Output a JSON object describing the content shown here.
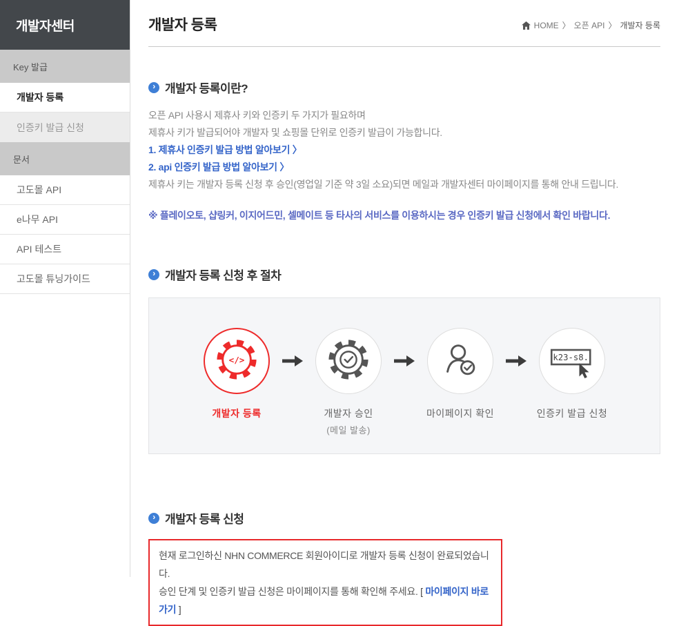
{
  "colors": {
    "accent_blue": "#3e7fd6",
    "link_blue": "#3464c9",
    "notice_indigo": "#5a69c3",
    "step_red": "#ee2b2b",
    "sidebar_dark": "#43474b"
  },
  "sidebar": {
    "title": "개발자센터",
    "items": [
      {
        "label": "Key 발급"
      },
      {
        "label": "개발자 등록"
      },
      {
        "label": "인증키 발급 신청"
      },
      {
        "label": "문서"
      },
      {
        "label": "고도몰 API"
      },
      {
        "label": "e나무 API"
      },
      {
        "label": "API 테스트"
      },
      {
        "label": "고도몰 튜닝가이드"
      }
    ]
  },
  "header": {
    "title": "개발자 등록",
    "breadcrumb": {
      "items": [
        "HOME",
        "오픈 API",
        "개발자 등록"
      ],
      "separator": "〉"
    }
  },
  "section1": {
    "heading": "개발자 등록이란?",
    "lines": [
      "오픈 API 사용시 제휴사 키와 인증키 두 가지가 필요하며",
      "제휴사 키가 발급되어야 개발자 및 쇼핑몰 단위로 인증키 발급이 가능합니다."
    ],
    "links": [
      {
        "label": "1. 제휴사 인증키 발급 방법 알아보기 〉"
      },
      {
        "label": "2. api 인증키 발급 방법 알아보기 〉"
      }
    ],
    "note": "제휴사 키는 개발자 등록 신청 후 승인(영업일 기준 약 3일 소요)되면 메일과 개발자센터 마이페이지를 통해 안내 드립니다.",
    "warning": "※ 플레이오토, 샵링커, 이지어드민, 셀메이트 등 타사의 서비스를 이용하시는 경우 인증키 발급 신청에서 확인 바랍니다."
  },
  "section2": {
    "heading": "개발자 등록 신청 후 절차",
    "steps": [
      {
        "label": "개발자 등록",
        "icon": "gear-code-icon",
        "icon_text": "</>"
      },
      {
        "label": "개발자 승인",
        "sublabel": "(메일 발송)",
        "icon": "gear-check-icon"
      },
      {
        "label": "마이페이지 확인",
        "icon": "person-check-icon"
      },
      {
        "label": "인증키 발급 신청",
        "icon": "key-box-icon",
        "icon_text": "k23-s8."
      }
    ]
  },
  "section3": {
    "heading": "개발자 등록 신청",
    "line1": "현재 로그인하신 NHN COMMERCE 회원아이디로 개발자 등록 신청이 완료되었습니다.",
    "line2": "승인 단계 및 인증키 발급 신청은 마이페이지를 통해 확인해 주세요.",
    "bracket_open": "[",
    "link_label": "마이페이지 바로가기",
    "bracket_close": "]"
  }
}
